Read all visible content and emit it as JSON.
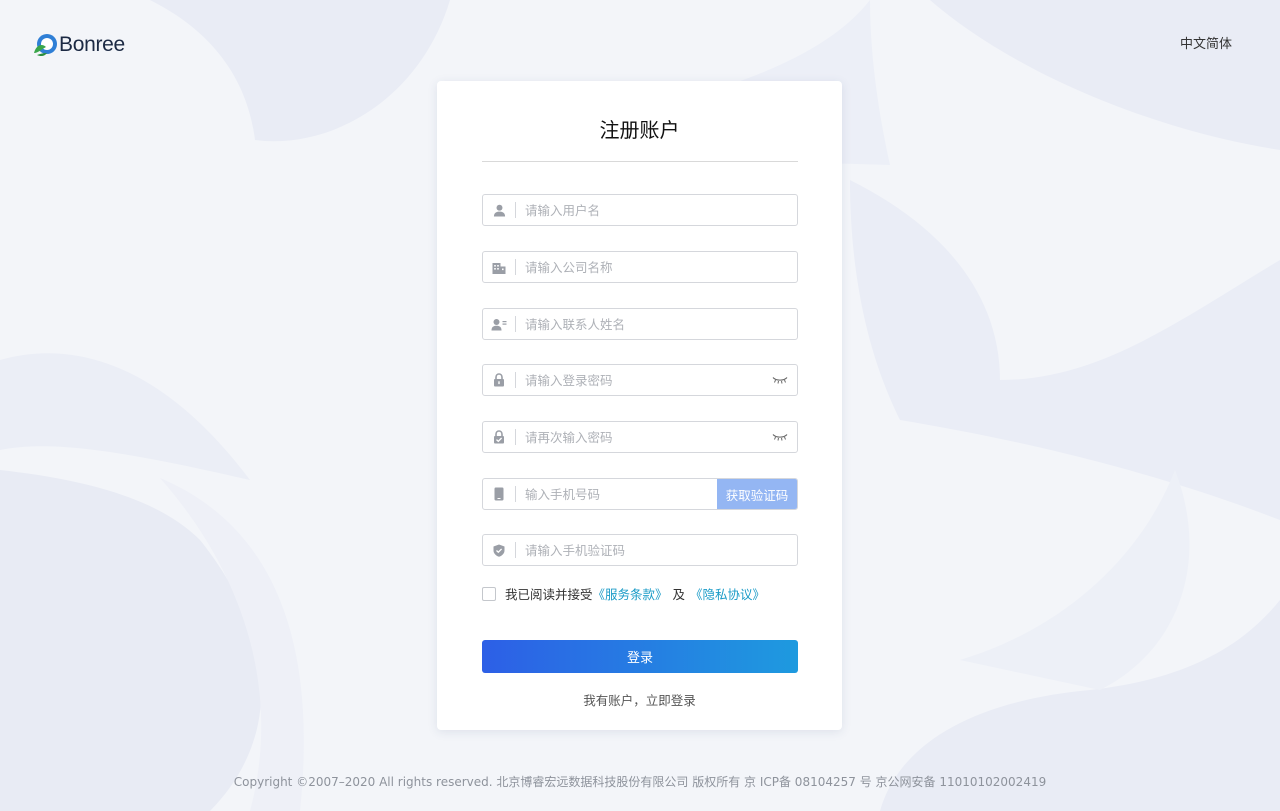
{
  "header": {
    "brand_name": "Bonree",
    "language": "中文简体"
  },
  "form": {
    "title": "注册账户",
    "fields": [
      {
        "placeholder": "请输入用户名",
        "icon": "user-icon"
      },
      {
        "placeholder": "请输入公司名称",
        "icon": "building-icon"
      },
      {
        "placeholder": "请输入联系人姓名",
        "icon": "contact-card-icon"
      },
      {
        "placeholder": "请输入登录密码",
        "icon": "lock-icon",
        "toggle_icon": "eye-closed-icon"
      },
      {
        "placeholder": "请再次输入密码",
        "icon": "lock-check-icon",
        "toggle_icon": "eye-closed-icon"
      },
      {
        "placeholder": "输入手机号码",
        "icon": "phone-icon"
      },
      {
        "placeholder": "请输入手机验证码",
        "icon": "shield-check-icon"
      }
    ],
    "get_code_label": "获取验证码",
    "agree_text": "我已阅读并接受",
    "terms_link": "《服务条款》",
    "and_text": "及",
    "privacy_link": "《隐私协议》",
    "submit_label": "登录",
    "login_link": "我有账户，立即登录"
  },
  "footer": {
    "copyright": "Copyright ©2007–2020 All rights reserved. 北京博睿宏远数据科技股份有限公司 版权所有 京 ICP备 08104257 号 京公网安备 11010102002419"
  },
  "colors": {
    "primary_gradient_start": "#2d5fe6",
    "primary_gradient_end": "#1e9adf",
    "link": "#1a9bc7",
    "code_button": "#94b6f3",
    "background": "#f3f5f9"
  }
}
